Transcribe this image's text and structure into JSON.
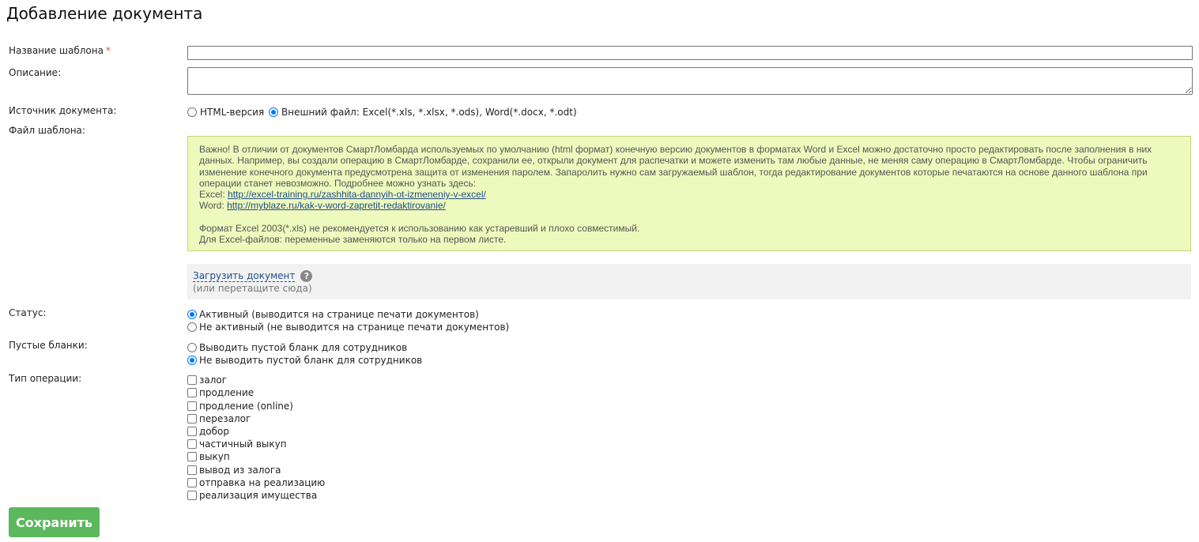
{
  "page": {
    "title": "Добавление документа"
  },
  "form": {
    "template_name": {
      "label": "Название шаблона",
      "required_mark": "*",
      "value": ""
    },
    "description": {
      "label": "Описание:",
      "value": ""
    },
    "source": {
      "label": "Источник документа:",
      "options": [
        {
          "label": "HTML-версия",
          "checked": false
        },
        {
          "label": "Внешний файл: Excel(*.xls, *.xlsx, *.ods), Word(*.docx, *.odt)",
          "checked": true
        }
      ]
    },
    "template_file": {
      "label": "Файл шаблона:",
      "note": {
        "paragraph1": "Важно! В отличии от документов СмартЛомбарда используемых по умолчанию (html формат) конечную версию документов в форматах Word и Excel можно достаточно просто редактировать после заполнения в них данных. Например, вы создали операцию в СмартЛомбарде, сохранили ее, открыли документ для распечатки и можете изменить там любые данные, не меняя саму операцию в СмартЛомбарде. Чтобы ограничить изменение конечного документа предусмотрена защита от изменения паролем. Запаролить нужно сам загружаемый шаблон, тогда редактирование документов которые печатаются на основе данного шаблона при операции станет невозможно. Подробнее можно узнать здесь:",
        "excel_prefix": "Excel: ",
        "excel_link": "http://excel-training.ru/zashhita-dannyih-ot-izmeneniy-v-excel/",
        "word_prefix": "Word: ",
        "word_link": "http://myblaze.ru/kak-v-word-zapretit-redaktirovanie/",
        "paragraph2": "Формат Excel 2003(*.xls) не рекомендуется к использованию как устаревший и плохо совместимый.",
        "paragraph3": "Для Excel-файлов: переменные заменяются только на первом листе."
      },
      "upload_link": "Загрузить документ",
      "help_icon_glyph": "?",
      "upload_hint": "(или перетащите сюда)"
    },
    "status": {
      "label": "Статус:",
      "options": [
        {
          "label": "Активный (выводится на странице печати документов)",
          "checked": true
        },
        {
          "label": "Не активный (не выводится на странице печати документов)",
          "checked": false
        }
      ]
    },
    "blank_forms": {
      "label": "Пустые бланки:",
      "options": [
        {
          "label": "Выводить пустой бланк для сотрудников",
          "checked": false
        },
        {
          "label": "Не выводить пустой бланк для сотрудников",
          "checked": true
        }
      ]
    },
    "operation_type": {
      "label": "Тип операции:",
      "options": [
        {
          "label": "залог",
          "checked": false
        },
        {
          "label": "продление",
          "checked": false
        },
        {
          "label": "продление (online)",
          "checked": false
        },
        {
          "label": "перезалог",
          "checked": false
        },
        {
          "label": "добор",
          "checked": false
        },
        {
          "label": "частичный выкуп",
          "checked": false
        },
        {
          "label": "выкуп",
          "checked": false
        },
        {
          "label": "вывод из залога",
          "checked": false
        },
        {
          "label": "отправка на реализацию",
          "checked": false
        },
        {
          "label": "реализация имущества",
          "checked": false
        }
      ]
    }
  },
  "actions": {
    "save_label": "Сохранить"
  },
  "colors": {
    "save_button": "#5cb85c",
    "note_background": "#eef9bd",
    "radio_checked": "#0075ff",
    "link": "#1e4d8a",
    "required": "#d9534f"
  }
}
